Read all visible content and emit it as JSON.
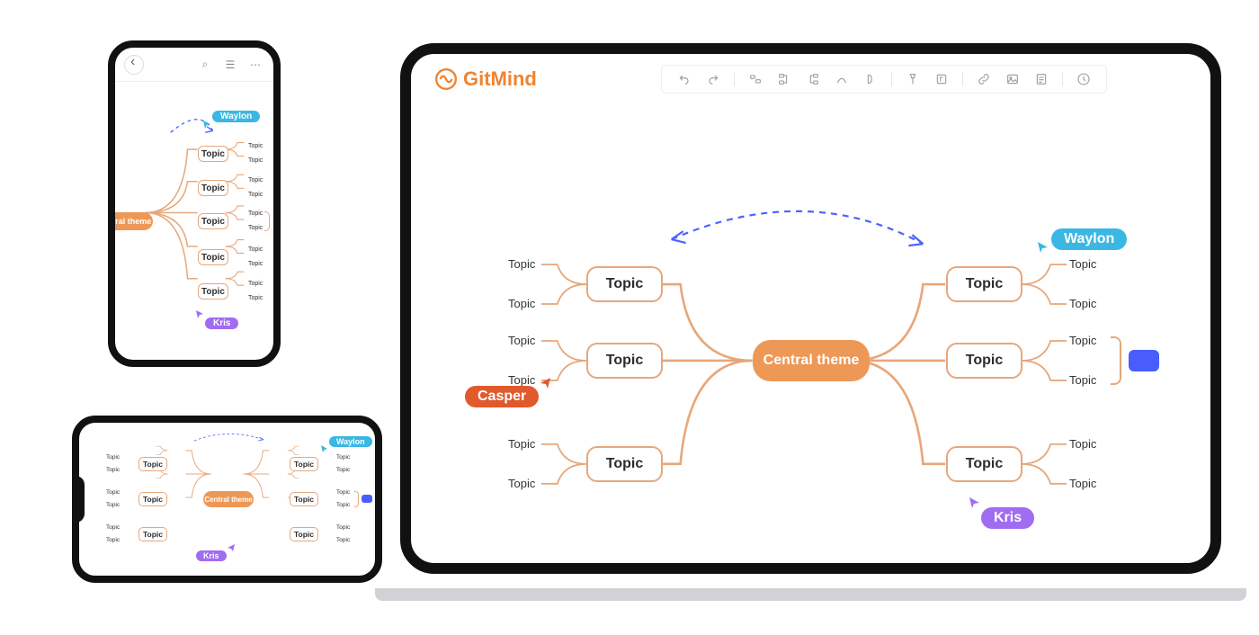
{
  "app": {
    "name": "GitMind"
  },
  "mindmap": {
    "central": "Central  theme",
    "topic": "Topic",
    "leaf": "Topic"
  },
  "users": {
    "waylon": "Waylon",
    "casper": "Casper",
    "kris": "Kris"
  },
  "colors": {
    "brand": "#ef8432",
    "node_border": "#e7a77a",
    "center_fill": "#ed9857",
    "waylon": "#3ab7e2",
    "casper": "#e05a2b",
    "kris": "#a06cf0",
    "accent_box": "#485dfc",
    "relation_line": "#4a63ff"
  }
}
